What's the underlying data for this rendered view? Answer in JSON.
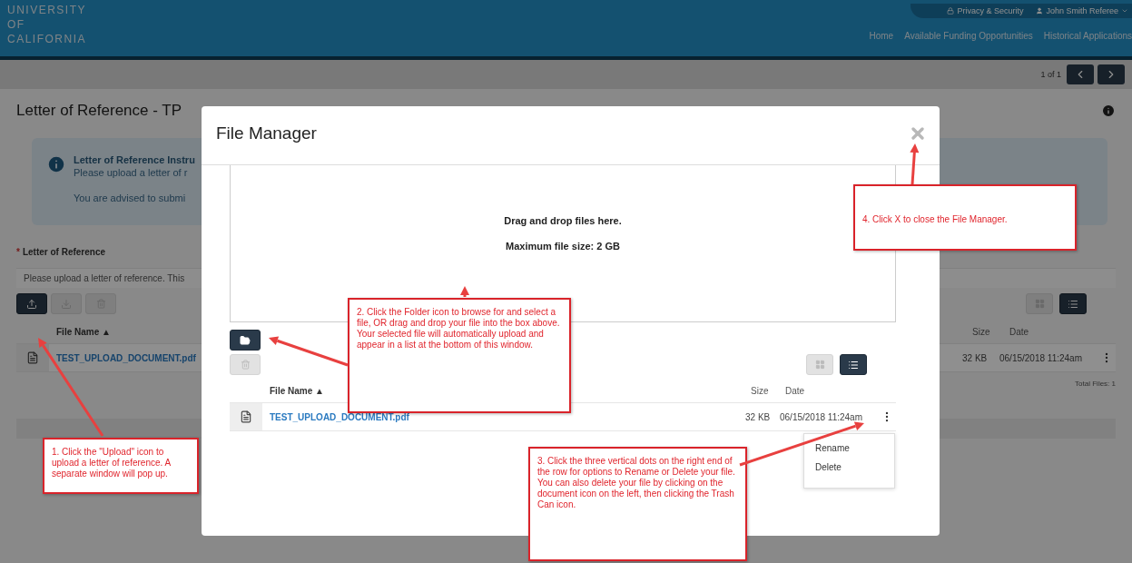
{
  "header": {
    "logo_lines": [
      "UNIVERSITY",
      "OF",
      "CALIFORNIA"
    ],
    "utility_links": [
      {
        "kind": "lock",
        "label": "Privacy & Security"
      },
      {
        "kind": "user",
        "label": "John Smith Referee"
      }
    ],
    "nav": [
      "Home",
      "Available Funding Opportunities",
      "Historical Applications"
    ]
  },
  "pager": {
    "text": "1 of 1"
  },
  "page": {
    "title": "Letter of Reference - TP",
    "info": {
      "title": "Letter of Reference Instru",
      "lines": [
        "Please upload a letter of r",
        "You are advised to submi"
      ]
    },
    "field": {
      "label": "Letter of Reference",
      "required": true,
      "required_mark": "*",
      "hint": "Please upload a letter of reference. This"
    },
    "actions": [
      {
        "kind": "upload",
        "disabled": false
      },
      {
        "kind": "download",
        "disabled": true
      },
      {
        "kind": "delete",
        "disabled": true
      }
    ],
    "views": [
      {
        "kind": "grid",
        "selected": false
      },
      {
        "kind": "list",
        "selected": true
      }
    ],
    "columns": [
      "File Name ▲",
      "Size",
      "Date"
    ],
    "files": [
      {
        "name": "TEST_UPLOAD_DOCUMENT.pdf",
        "size": "32 KB",
        "date": "06/15/2018 11:24am"
      }
    ],
    "total": "Total Files: 1"
  },
  "modal": {
    "title": "File Manager",
    "dropzone": [
      "Drag and drop files here.",
      "Maximum file size: 2 GB"
    ],
    "actions": [
      {
        "kind": "folder",
        "disabled": false
      },
      {
        "kind": "delete",
        "disabled": true
      }
    ],
    "views": [
      {
        "kind": "grid",
        "selected": false
      },
      {
        "kind": "list",
        "selected": true
      }
    ],
    "columns": [
      "File Name ▲",
      "Size",
      "Date"
    ],
    "files": [
      {
        "name": "TEST_UPLOAD_DOCUMENT.pdf",
        "size": "32 KB",
        "date": "06/15/2018 11:24am"
      }
    ],
    "menu": {
      "open": true,
      "items": [
        "Rename",
        "Delete"
      ]
    }
  },
  "callouts": [
    "1. Click the \"Upload\" icon to upload a letter of reference. A separate window will pop up.",
    "2. Click the Folder icon to browse for and select a file, OR drag and drop your file into the box above. Your selected file will automatically upload and appear in a list at the bottom of this window.",
    "3. Click the three vertical dots on the right end of the row for options to Rename or Delete your file. You can also delete your file by clicking on the document icon on the left, then clicking the Trash Can icon.",
    "4. Click X to close the File Manager."
  ]
}
